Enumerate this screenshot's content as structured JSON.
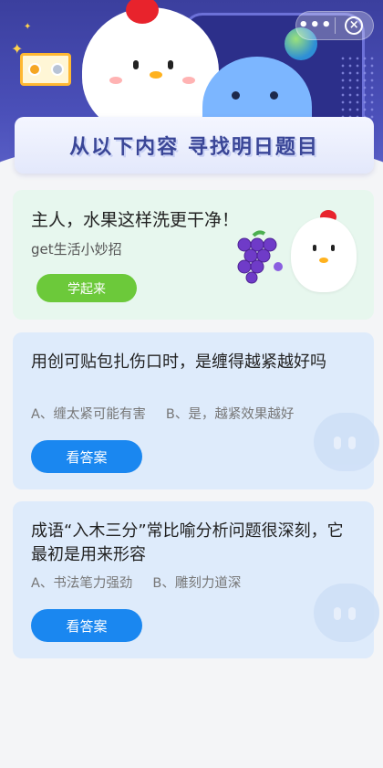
{
  "header": {
    "title": "从以下内容 寻找明日题目",
    "more_label": "•••",
    "close_label": "×"
  },
  "promo": {
    "title": "主人，水果这样洗更干净！",
    "subtitle": "get生活小妙招",
    "button_label": "学起来"
  },
  "questions": [
    {
      "text": "用创可贴包扎伤口时，是缠得越紧越好吗",
      "option_a": "A、缠太紧可能有害",
      "option_b": "B、是，越紧效果越好",
      "button_label": "看答案"
    },
    {
      "text": "成语“入木三分”常比喻分析问题很深刻，它最初是用来形容",
      "option_a": "A、书法笔力强劲",
      "option_b": "B、雕刻力道深",
      "button_label": "看答案"
    }
  ],
  "colors": {
    "accent_blue": "#1a87f0",
    "accent_green": "#6cc93a",
    "hero_purple": "#3b3f9e"
  }
}
